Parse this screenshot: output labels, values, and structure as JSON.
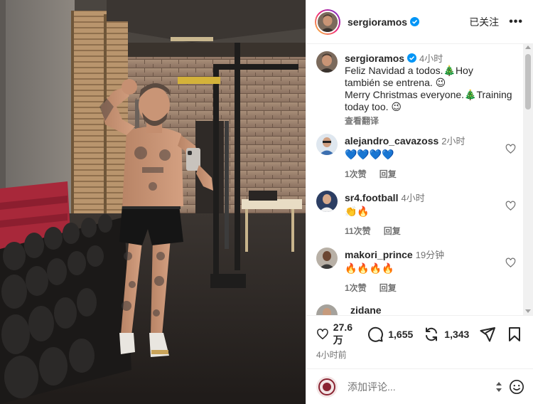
{
  "post": {
    "username": "sergioramos",
    "follow_label": "已关注",
    "more_label": "•••"
  },
  "caption": {
    "username": "sergioramos",
    "time": "4小时",
    "line1": "Feliz Navidad a todos.🎄Hoy",
    "line2": "también se entrena. 😉",
    "line3": "Merry Christmas everyone.🎄Training",
    "line4": "today too. 😉",
    "translate": "查看翻译"
  },
  "comments": [
    {
      "username": "alejandro_cavazoss",
      "time": "2小时",
      "text": "💙💙💙💙",
      "likes": "1次赞",
      "reply": "回复"
    },
    {
      "username": "sr4.football",
      "time": "4小时",
      "text": "👏🔥",
      "likes": "11次赞",
      "reply": "回复"
    },
    {
      "username": "makori_prince",
      "time": "19分钟",
      "text": "🔥🔥🔥🔥",
      "likes": "1次赞",
      "reply": "回复"
    },
    {
      "username": "zidane",
      "time": "",
      "text": "",
      "likes": "",
      "reply": ""
    }
  ],
  "actions": {
    "likes": "27.6 万",
    "comments": "1,655",
    "shares": "1,343",
    "posted": "4小时前"
  },
  "composer": {
    "placeholder": "添加评论..."
  },
  "icons": {
    "verified": "verified-badge-icon",
    "like": "heart-icon",
    "comment": "comment-icon",
    "repost": "repost-icon",
    "share": "share-icon",
    "save": "bookmark-icon",
    "emoji": "emoji-icon"
  },
  "colors": {
    "verified": "#0095f6",
    "text": "#262626",
    "secondary": "#737373",
    "border": "#efefef"
  }
}
